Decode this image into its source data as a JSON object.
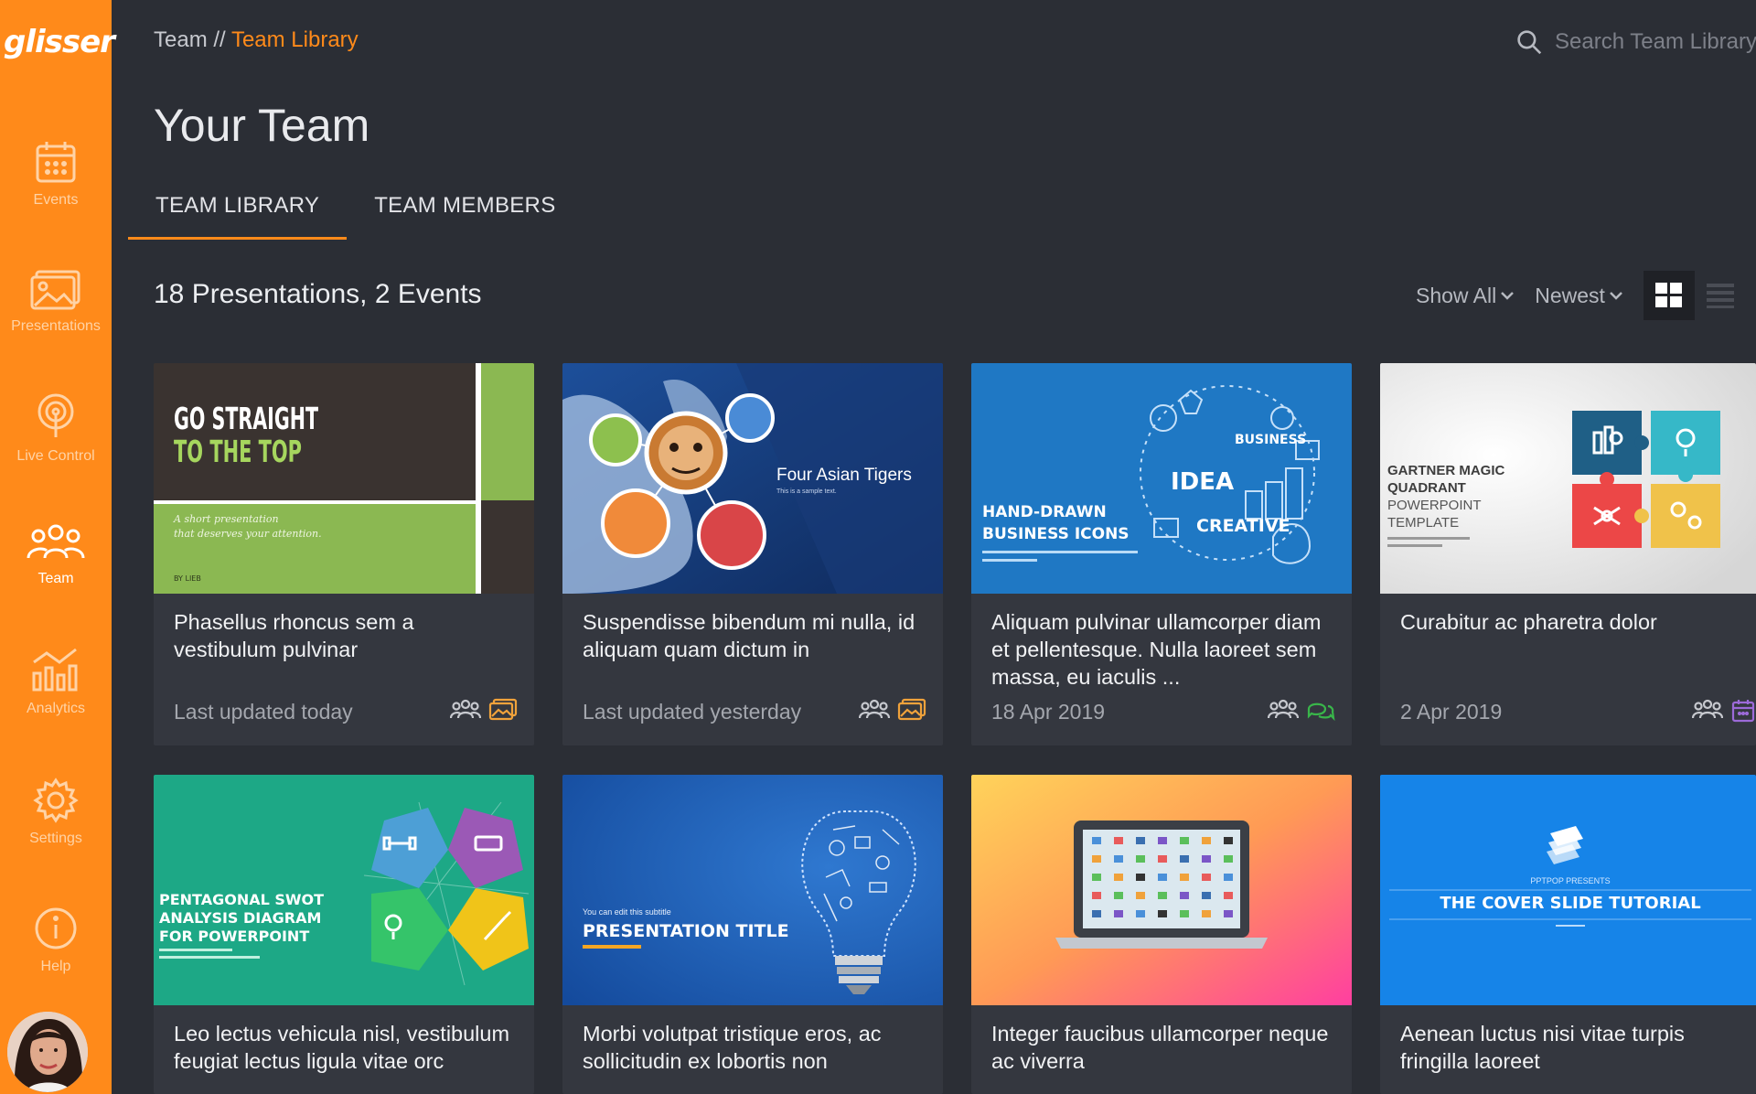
{
  "sidebar": {
    "logo": "glisser",
    "items": [
      {
        "label": "Events",
        "icon": "calendar-icon"
      },
      {
        "label": "Presentations",
        "icon": "image-icon"
      },
      {
        "label": "Live Control",
        "icon": "broadcast-icon"
      },
      {
        "label": "Team",
        "icon": "team-icon",
        "active": true
      },
      {
        "label": "Analytics",
        "icon": "analytics-icon"
      },
      {
        "label": "Settings",
        "icon": "gear-icon"
      },
      {
        "label": "Help",
        "icon": "info-icon"
      }
    ],
    "accent": "#ff8a1a"
  },
  "breadcrumb": {
    "root": "Team //",
    "current": "Team Library"
  },
  "search": {
    "placeholder": "Search Team Library"
  },
  "page": {
    "title": "Your Team"
  },
  "tabs": [
    {
      "label": "TEAM LIBRARY",
      "active": true
    },
    {
      "label": "TEAM MEMBERS",
      "active": false
    }
  ],
  "summary": "18 Presentations, 2 Events",
  "controls": {
    "filter": "Show All",
    "sort": "Newest",
    "view": "grid"
  },
  "cards": [
    {
      "title": "Phasellus rhoncus sem a vestibulum pulvinar",
      "meta": "Last updated today",
      "thumb": {
        "line1": "GO STRAIGHT",
        "line2": "TO THE TOP",
        "sub1": "A short presentation",
        "sub2": "that deserves your attention.",
        "by": "BY LIEB"
      },
      "icons": [
        "team-icon",
        "presentation-icon"
      ]
    },
    {
      "title": "Suspendisse bibendum mi nulla, id aliquam quam dictum in",
      "meta": "Last updated yesterday",
      "thumb": {
        "heading": "Four Asian Tigers",
        "sub": "This is a sample text."
      },
      "icons": [
        "team-icon",
        "presentation-icon"
      ]
    },
    {
      "title": "Aliquam pulvinar ullamcorper diam et pellentesque. Nulla laoreet sem massa, eu iaculis ...",
      "meta": "18 Apr 2019",
      "thumb": {
        "line1": "HAND-DRAWN",
        "line2": "BUSINESS ICONS",
        "word1": "IDEA",
        "word2": "CREATIVE",
        "word3": "BUSINESS"
      },
      "icons": [
        "team-icon",
        "chat-icon"
      ]
    },
    {
      "title": "Curabitur ac pharetra dolor",
      "meta": "2 Apr 2019",
      "thumb": {
        "line1": "GARTNER MAGIC",
        "line2": "QUADRANT",
        "line3": "POWERPOINT",
        "line4": "TEMPLATE"
      },
      "icons": [
        "team-icon",
        "calendar-icon"
      ]
    },
    {
      "title": "Leo lectus vehicula nisl, vestibulum feugiat lectus ligula vitae orc",
      "meta": "",
      "thumb": {
        "line1": "PENTAGONAL SWOT",
        "line2": "ANALYSIS DIAGRAM",
        "line3": "FOR POWERPOINT"
      },
      "icons": []
    },
    {
      "title": "Morbi volutpat tristique eros, ac sollicitudin ex lobortis non",
      "meta": "",
      "thumb": {
        "sub": "You can edit this subtitle",
        "line1": "PRESENTATION TITLE"
      },
      "icons": []
    },
    {
      "title": "Integer faucibus ullamcorper neque ac viverra",
      "meta": "",
      "thumb": {},
      "icons": []
    },
    {
      "title": "Aenean luctus nisi vitae turpis fringilla laoreet",
      "meta": "",
      "thumb": {
        "pre": "PPTPOP PRESENTS",
        "line1": "THE COVER SLIDE TUTORIAL"
      },
      "icons": []
    }
  ]
}
